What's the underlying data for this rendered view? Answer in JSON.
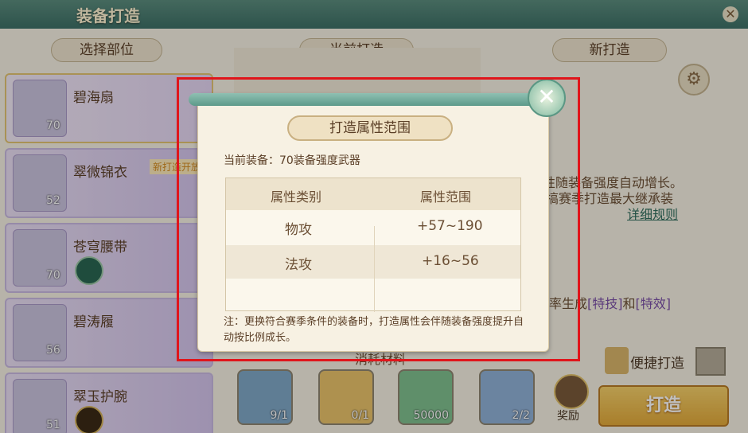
{
  "window": {
    "title": "装备打造",
    "top_right_text": "",
    "close_icon": "close-icon"
  },
  "headers": {
    "select_part": "选择部位",
    "current_forge": "当前打造",
    "new_forge": "新打造"
  },
  "left_list": [
    {
      "name": "碧海扇",
      "level": "70",
      "tag": "",
      "selected": true
    },
    {
      "name": "翠微锦衣",
      "level": "52",
      "tag": "新打造开放",
      "selected": false
    },
    {
      "name": "苍穹腰带",
      "level": "70",
      "tag": "",
      "selected": false
    },
    {
      "name": "碧涛履",
      "level": "56",
      "tag": "",
      "selected": false
    },
    {
      "name": "翠玉护腕",
      "level": "51",
      "tag": "",
      "selected": false
    }
  ],
  "right_panel": {
    "line1": "性随装备强度自动增长。",
    "line2": "搞赛季打造最大继承装",
    "detail_rules": "详细规则",
    "line3_prefix": "率生成",
    "special_skill": "[特技]",
    "and": "和",
    "special_effect": "[特效]"
  },
  "consume_label": "消耗材料",
  "quick_forge_label": "便捷打造",
  "materials": [
    {
      "count": "9/1"
    },
    {
      "count": "0/1"
    },
    {
      "count": "50000"
    },
    {
      "count": "2/2"
    }
  ],
  "reward_label": "奖励",
  "forge_button_label": "打造",
  "dialog": {
    "title": "打造属性范围",
    "current_equip": "当前装备：70装备强度武器",
    "table": {
      "col1": "属性类别",
      "col2": "属性范围",
      "rows": [
        {
          "type": "物攻",
          "range": "+57~190"
        },
        {
          "type": "法攻",
          "range": "+16~56"
        }
      ]
    },
    "note": "注：更换符合赛季条件的装备时，打造属性会伴随装备强度提升自动按比例成长。"
  },
  "colors": {
    "accent": "#5d9a8a",
    "highlight": "#e0151b"
  }
}
